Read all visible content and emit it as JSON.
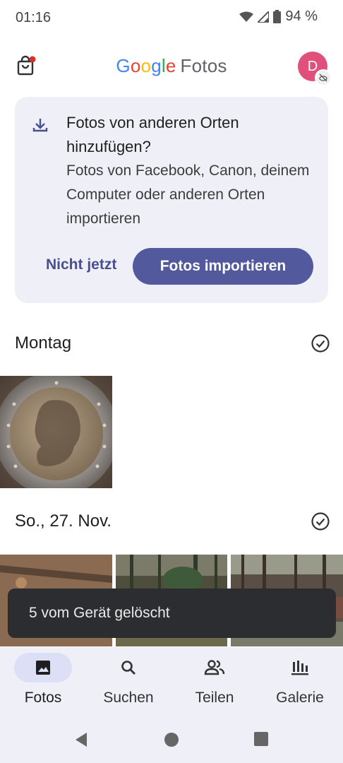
{
  "status_bar": {
    "time": "01:16",
    "battery_percent": "94 %"
  },
  "app_bar": {
    "logo_google": [
      "G",
      "o",
      "o",
      "g",
      "l",
      "e"
    ],
    "logo_fotos": "Fotos",
    "avatar_initial": "D"
  },
  "import_card": {
    "title": "Fotos von anderen Orten hinzufügen?",
    "description": "Fotos von Facebook, Canon, deinem Computer oder anderen Orten importieren",
    "not_now_label": "Nicht jetzt",
    "import_label": "Fotos importieren"
  },
  "sections": [
    {
      "label": "Montag"
    },
    {
      "label": "So., 27. Nov."
    }
  ],
  "snackbar": {
    "message": "5 vom Gerät gelöscht"
  },
  "bottom_nav": {
    "items": [
      {
        "label": "Fotos",
        "icon": "photo-icon",
        "active": true
      },
      {
        "label": "Suchen",
        "icon": "search-icon",
        "active": false
      },
      {
        "label": "Teilen",
        "icon": "people-icon",
        "active": false
      },
      {
        "label": "Galerie",
        "icon": "library-icon",
        "active": false
      }
    ]
  },
  "colors": {
    "accent": "#52599d",
    "card_bg": "#eff0f7",
    "avatar": "#e0507a",
    "snackbar": "#2c2d30"
  }
}
